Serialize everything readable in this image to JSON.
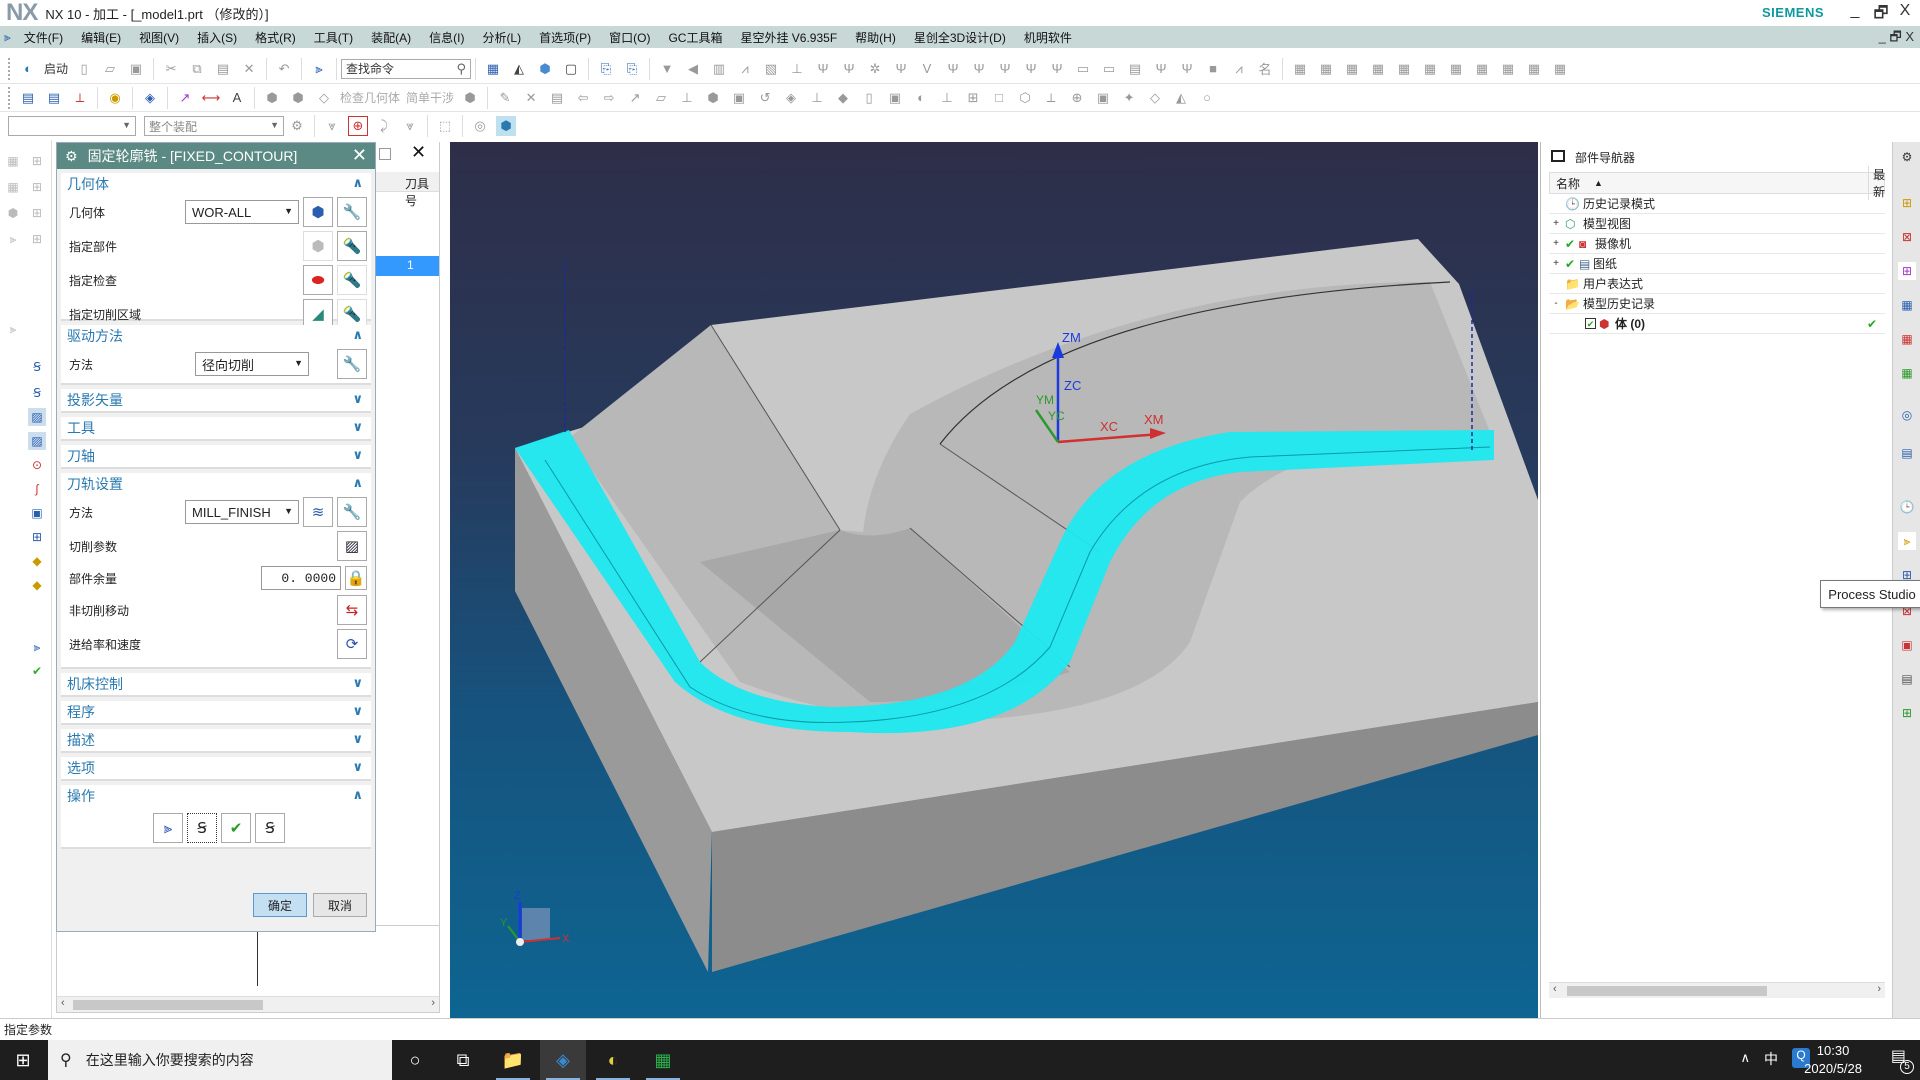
{
  "window": {
    "logo": "NX",
    "title": "NX 10 - 加工 - [_model1.prt （修改的）]",
    "brand": "SIEMENS",
    "controls": {
      "minimize": "_",
      "restore": "🗗",
      "close": "X"
    }
  },
  "menubar": {
    "items": [
      "文件(F)",
      "编辑(E)",
      "视图(V)",
      "插入(S)",
      "格式(R)",
      "工具(T)",
      "装配(A)",
      "信息(I)",
      "分析(L)",
      "首选项(P)",
      "窗口(O)",
      "GC工具箱",
      "星空外挂 V6.935F",
      "帮助(H)",
      "星创全3D设计(D)",
      "机明软件"
    ]
  },
  "toolbar": {
    "start_label": "启动",
    "search_placeholder": "查找命令",
    "check_geometry": "检查几何体",
    "simple_interference": "简单干涉",
    "filter_value": "",
    "assembly_scope": "整个装配"
  },
  "dialog": {
    "title": "固定轮廓铣 - [FIXED_CONTOUR]",
    "groups": {
      "geometry": {
        "title": "几何体",
        "geometry_label": "几何体",
        "geometry_value": "WOR-ALL",
        "specify_part": "指定部件",
        "specify_check": "指定检查",
        "specify_cut_area": "指定切削区域"
      },
      "drive_method": {
        "title": "驱动方法",
        "method_label": "方法",
        "method_value": "径向切削"
      },
      "projection_vector": {
        "title": "投影矢量"
      },
      "tool": {
        "title": "工具"
      },
      "tool_axis": {
        "title": "刀轴"
      },
      "path_settings": {
        "title": "刀轨设置",
        "method_label": "方法",
        "method_value": "MILL_FINISH",
        "cut_params": "切削参数",
        "part_stock": "部件余量",
        "part_stock_value": "0. 0000",
        "non_cutting": "非切削移动",
        "feeds_speeds": "进给率和速度"
      },
      "machine_control": {
        "title": "机床控制"
      },
      "program": {
        "title": "程序"
      },
      "description": {
        "title": "描述"
      },
      "options": {
        "title": "选项"
      },
      "actions": {
        "title": "操作"
      }
    },
    "ok_label": "确定",
    "cancel_label": "取消"
  },
  "operation_navigator": {
    "column_header": "刀具号",
    "selected_value": "1"
  },
  "viewport": {
    "wcs_labels": {
      "zm": "ZM",
      "zc": "ZC",
      "ym": "YM",
      "yc": "YC",
      "xc": "XC",
      "xm": "XM"
    },
    "triad_labels": {
      "x": "X",
      "y": "Y",
      "z": "Z"
    },
    "colors": {
      "toolpath": "#1ee8f0",
      "part": "#c8c8c8"
    }
  },
  "part_navigator": {
    "title": "部件导航器",
    "col_name": "名称",
    "col_latest": "最新",
    "nodes": [
      {
        "label": "历史记录模式",
        "icon": "clock-icon",
        "expander": "",
        "check": false
      },
      {
        "label": "模型视图",
        "icon": "model-view-icon",
        "expander": "+",
        "check": false
      },
      {
        "label": "摄像机",
        "icon": "camera-icon",
        "expander": "+",
        "check": true
      },
      {
        "label": "图纸",
        "icon": "drawing-icon",
        "expander": "+",
        "check": true
      },
      {
        "label": "用户表达式",
        "icon": "folder-icon",
        "expander": "",
        "check": false
      },
      {
        "label": "模型历史记录",
        "icon": "folder-open-icon",
        "expander": "-",
        "check": false
      },
      {
        "label": "体 (0)",
        "icon": "body-icon",
        "expander": "",
        "check": true,
        "latest": "✔"
      }
    ]
  },
  "tooltip": "Process Studio",
  "statusbar": {
    "prompt": "指定参数"
  },
  "taskbar": {
    "search_placeholder": "在这里输入你要搜索的内容",
    "time": "10:30",
    "date": "2020/5/28",
    "ime": "中",
    "notifications": "5"
  }
}
